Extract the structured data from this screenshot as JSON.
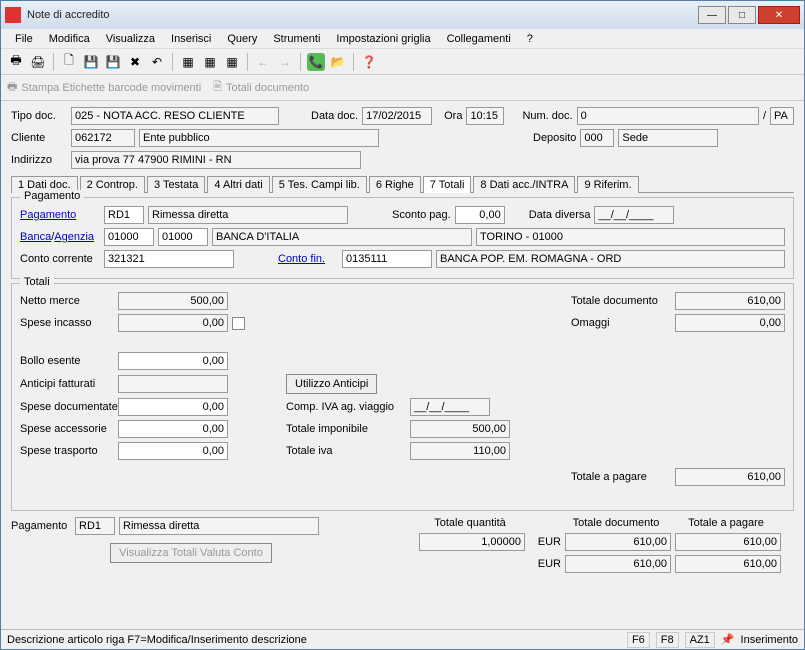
{
  "window": {
    "title": "Note di accredito"
  },
  "menu": {
    "file": "File",
    "modifica": "Modifica",
    "visualizza": "Visualizza",
    "inserisci": "Inserisci",
    "query": "Query",
    "strumenti": "Strumenti",
    "impostazioni": "Impostazioni griglia",
    "collegamenti": "Collegamenti",
    "help": "?"
  },
  "actionbar": {
    "stampa": "Stampa Etichette barcode movimenti",
    "totali": "Totali documento"
  },
  "header": {
    "tipoDocLbl": "Tipo doc.",
    "tipoDoc": "025 - NOTA ACC. RESO CLIENTE",
    "dataDocLbl": "Data doc.",
    "dataDoc": "17/02/2015",
    "oraLbl": "Ora",
    "ora": "10:15",
    "numDocLbl": "Num. doc.",
    "numDoc": "0",
    "numDocSuffix": "PA",
    "clienteLbl": "Cliente",
    "clienteCod": "062172",
    "clienteDesc": "Ente pubblico",
    "depositoLbl": "Deposito",
    "depositoCod": "000",
    "depositoDesc": "Sede",
    "indirizzoLbl": "Indirizzo",
    "indirizzo": "via prova 77   47900   RIMINI    - RN"
  },
  "tabs": {
    "t1": "1 Dati doc.",
    "t2": "2 Controp.",
    "t3": "3 Testata",
    "t4": "4 Altri dati",
    "t5": "5 Tes. Campi lib.",
    "t6": "6 Righe",
    "t7": "7 Totali",
    "t8": "8 Dati acc./INTRA",
    "t9": "9 Riferim."
  },
  "pagamento": {
    "legend": "Pagamento",
    "pagamentoLink": "Pagamento",
    "pagamentoCod": "RD1",
    "pagamentoDesc": "Rimessa diretta",
    "scontoLbl": "Sconto pag.",
    "sconto": "0,00",
    "dataDiversaLbl": "Data diversa",
    "dataDiversa": "__/__/____",
    "bancaLink": "Banca",
    "agenziaLink": "Agenzia",
    "bancaCod": "01000",
    "agenziaCod": "01000",
    "bancaDesc": "BANCA D'ITALIA",
    "filiale": "TORINO - 01000",
    "contoCorrLbl": "Conto corrente",
    "contoCorr": "321321",
    "contoFinLink": "Conto fin.",
    "contoFin": "0135111",
    "contoFinDesc": "BANCA POP. EM. ROMAGNA - ORD"
  },
  "totali": {
    "legend": "Totali",
    "nettoMerceLbl": "Netto merce",
    "nettoMerce": "500,00",
    "totDocLbl": "Totale documento",
    "totDoc": "610,00",
    "speseIncassoLbl": "Spese incasso",
    "speseIncasso": "0,00",
    "omaggiLbl": "Omaggi",
    "omaggi": "0,00",
    "bolloLbl": "Bollo esente",
    "bollo": "0,00",
    "anticipiLbl": "Anticipi fatturati",
    "anticipi": "",
    "utilizzoBtn": "Utilizzo Anticipi",
    "speseDocLbl": "Spese documentate",
    "speseDoc": "0,00",
    "compIvaLbl": "Comp. IVA ag. viaggio",
    "compIva": "__/__/____",
    "speseAccLbl": "Spese accessorie",
    "speseAcc": "0,00",
    "totImpLbl": "Totale imponibile",
    "totImp": "500,00",
    "speseTraspLbl": "Spese trasporto",
    "speseTrasp": "0,00",
    "totIvaLbl": "Totale iva",
    "totIva": "110,00",
    "totPagareLbl": "Totale a pagare",
    "totPagare": "610,00"
  },
  "footer": {
    "pagamentoLbl": "Pagamento",
    "pagCod": "RD1",
    "pagDesc": "Rimessa diretta",
    "visualizzaBtn": "Visualizza Totali  Valuta Conto",
    "totQtaLbl": "Totale quantità",
    "totQta": "1,00000",
    "totDocLbl": "Totale documento",
    "totPagLbl": "Totale a pagare",
    "eur": "EUR",
    "val1a": "610,00",
    "val1b": "610,00",
    "val2a": "610,00",
    "val2b": "610,00"
  },
  "status": {
    "desc": "Descrizione articolo riga   F7=Modifica/Inserimento descrizione",
    "f6": "F6",
    "f8": "F8",
    "az1": "AZ1",
    "mode": "Inserimento"
  }
}
